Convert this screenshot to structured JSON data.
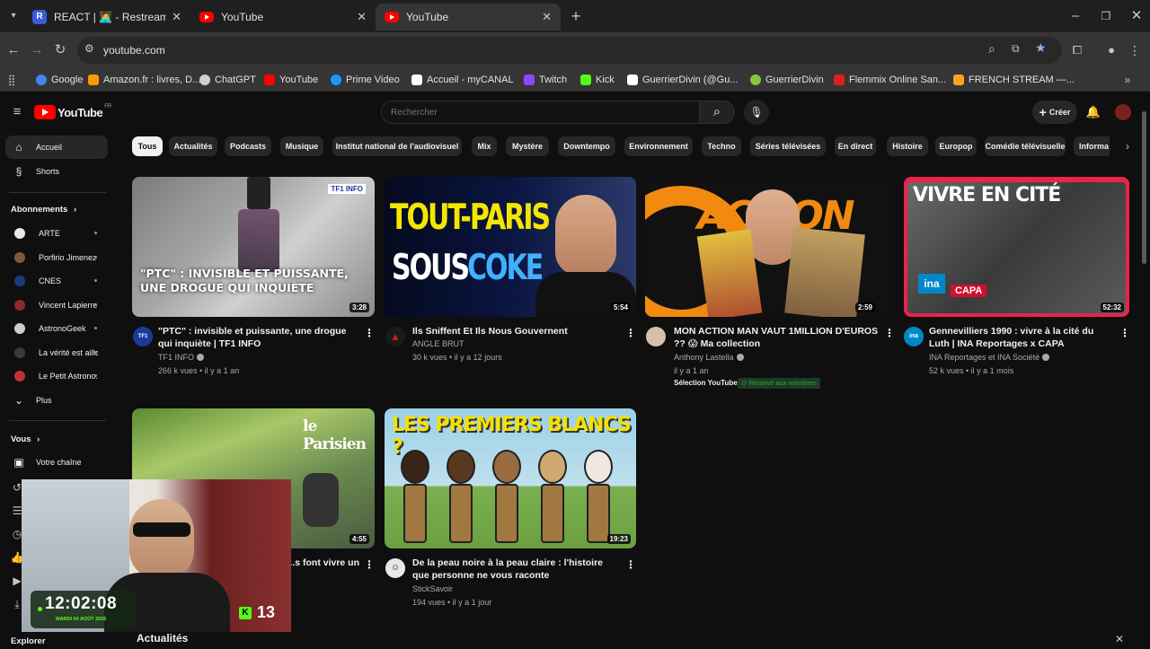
{
  "browser": {
    "tabs": [
      {
        "title": "REACT | 🧑‍💻 - Restream",
        "favicon": "restream-icon",
        "active": false
      },
      {
        "title": "YouTube",
        "favicon": "youtube-icon",
        "active": false
      },
      {
        "title": "YouTube",
        "favicon": "youtube-icon",
        "active": true
      }
    ],
    "new_tab": "+",
    "url": "youtube.com",
    "bookmarks": [
      {
        "label": "Google",
        "icon": "google-icon",
        "color": "#4285f4"
      },
      {
        "label": "Amazon.fr : livres, D...",
        "icon": "amazon-icon",
        "color": "#ff9900"
      },
      {
        "label": "ChatGPT",
        "icon": "chatgpt-icon",
        "color": "#d0d0d0"
      },
      {
        "label": "YouTube",
        "icon": "youtube-icon",
        "color": "#ff0000"
      },
      {
        "label": "Prime Video",
        "icon": "prime-video-icon",
        "color": "#1a98ff"
      },
      {
        "label": "Accueil - myCANAL",
        "icon": "plus-icon",
        "color": "#ffffff"
      },
      {
        "label": "Twitch",
        "icon": "twitch-icon",
        "color": "#9146ff"
      },
      {
        "label": "Kick",
        "icon": "kick-icon",
        "color": "#53fc18"
      },
      {
        "label": "GuerrierDivin (@Gu...",
        "icon": "x-icon",
        "color": "#ffffff"
      },
      {
        "label": "GuerrierDivin",
        "icon": "rumble-icon",
        "color": "#85c742"
      },
      {
        "label": "Flemmix Online San...",
        "icon": "flemmix-icon",
        "color": "#e02020"
      },
      {
        "label": "FRENCH STREAM —...",
        "icon": "play-icon",
        "color": "#f5a623"
      }
    ]
  },
  "youtube": {
    "logo": "YouTube",
    "logo_region": "FR",
    "search_placeholder": "Rechercher",
    "create_label": "Créer",
    "chips": [
      "Tous",
      "Actualités",
      "Podcasts",
      "Musique",
      "Institut national de l'audiovisuel",
      "Mix",
      "Mystère",
      "Downtempo",
      "Environnement",
      "Techno",
      "Séries télévisées",
      "En direct",
      "Histoire",
      "Europop",
      "Comédie télévisuelle",
      "Informa"
    ],
    "sidebar": {
      "home": "Accueil",
      "shorts": "Shorts",
      "subscriptions_header": "Abonnements",
      "subscriptions": [
        {
          "name": "ARTE",
          "color": "#e8e8e8"
        },
        {
          "name": "Porfirio Jimenez ...",
          "color": "#7a5a3a"
        },
        {
          "name": "CNES",
          "color": "#1a3a7a"
        },
        {
          "name": "Vincent Lapierre",
          "color": "#8a2a2a"
        },
        {
          "name": "AstronoGeek",
          "color": "#cccccc"
        },
        {
          "name": "La vérité est aille...",
          "color": "#3a3a3a"
        },
        {
          "name": "Le Petit Astrono...",
          "color": "#c03030"
        }
      ],
      "more": "Plus",
      "you_header": "Vous",
      "your_channel": "Votre chaîne",
      "explore": "Explorer"
    },
    "videos": [
      {
        "title": "\"PTC\" : invisible et puissante, une drogue qui inquiète | TF1 INFO",
        "channel": "TF1 INFO",
        "stats": "266 k vues • il y a 1 an",
        "duration": "3:28",
        "thumb_text": "\"PTC\" : INVISIBLE ET PUISSANTE, UNE DROGUE QUI INQUIÈTE",
        "thumb_badge": "TF1 INFO",
        "verified": true
      },
      {
        "title": "Ils Sniffent Et Ils Nous Gouvernent",
        "channel": "ANGLE BRUT",
        "stats": "30 k vues • il y a 12 jours",
        "duration": "5:54",
        "thumb_text_1": "TOUT-PARIS",
        "thumb_text_2": "SOUS",
        "thumb_text_3": "COKE",
        "verified": false
      },
      {
        "title": "MON ACTION MAN VAUT 1MILLION D'EUROS ?? 😱 Ma collection",
        "channel": "Anthony Lastella",
        "stats": "il y a 1 an",
        "extra_1": "Sélection YouTube",
        "extra_2": "Réservé aux membres",
        "duration": "2:59",
        "thumb_text": "ACTION",
        "verified": true
      },
      {
        "title": "Gennevilliers 1990 : vivre à la cité du Luth | INA Reportages x CAPA",
        "channel": "INA Reportages et INA Société",
        "stats": "52 k vues • il y a 1 mois",
        "duration": "52:32",
        "thumb_text": "VIVRE EN CITÉ",
        "thumb_badge_1": "ina",
        "thumb_badge_2": "CAPA",
        "verified": true
      },
      {
        "title": "...s font vivre un",
        "channel": "",
        "stats": "",
        "duration": "4:55",
        "thumb_text": "le Parisien",
        "verified": false
      },
      {
        "title": "De la peau noire à la peau claire : l'histoire que personne ne vous raconte",
        "channel": "StickSavoir",
        "stats": "194 vues • il y a 1 jour",
        "duration": "19:23",
        "thumb_text": "LES PREMIERS BLANCS ?",
        "verified": false
      }
    ],
    "bottom_section": "Actualités"
  },
  "webcam": {
    "time": "12:02:08",
    "date": "MARDI 04 AOÛT 2026",
    "kick_count": "13"
  },
  "colors": {
    "accent": "#ff0000",
    "bg": "#0f0f0f",
    "chip": "#272727",
    "link": "#3ea6ff"
  }
}
